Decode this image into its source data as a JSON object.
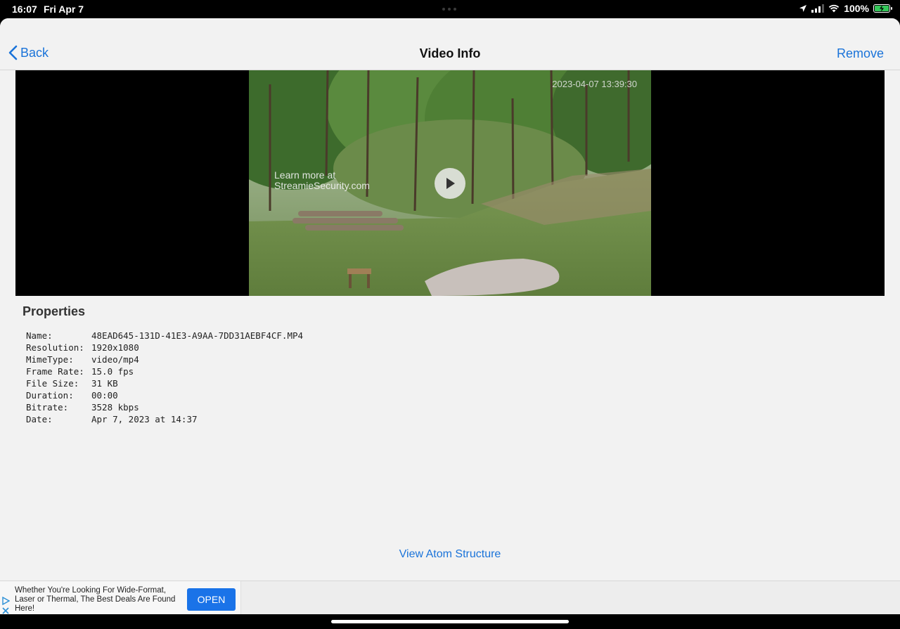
{
  "status_bar": {
    "time": "16:07",
    "date": "Fri Apr 7",
    "battery": "100%",
    "icons": [
      "location-icon",
      "cellular-signal-icon",
      "wifi-icon",
      "battery-charging-icon"
    ]
  },
  "nav": {
    "back_label": "Back",
    "title": "Video Info",
    "remove_label": "Remove"
  },
  "video": {
    "timestamp": "2023-04-07 13:39:30",
    "watermark_line1": "Learn more at",
    "watermark_line2": "StreamieSecurity.com"
  },
  "properties": {
    "header": "Properties",
    "rows": [
      {
        "key": "Name:",
        "value": "48EAD645-131D-41E3-A9AA-7DD31AEBF4CF.MP4"
      },
      {
        "key": "Resolution:",
        "value": "1920x1080"
      },
      {
        "key": "MimeType:",
        "value": "video/mp4"
      },
      {
        "key": "Frame Rate:",
        "value": "15.0 fps"
      },
      {
        "key": "File Size:",
        "value": "31 KB"
      },
      {
        "key": "Duration:",
        "value": "00:00"
      },
      {
        "key": "Bitrate:",
        "value": "3528 kbps"
      },
      {
        "key": "Date:",
        "value": "Apr 7, 2023 at 14:37"
      }
    ]
  },
  "view_atom_label": "View Atom Structure",
  "ad": {
    "text": "Whether You're Looking For Wide-Format, Laser or Thermal, The Best Deals Are Found Here!",
    "open_label": "OPEN"
  },
  "colors": {
    "accent": "#1a73d9",
    "background": "#f2f2f2",
    "ad_button": "#1a73e8"
  }
}
